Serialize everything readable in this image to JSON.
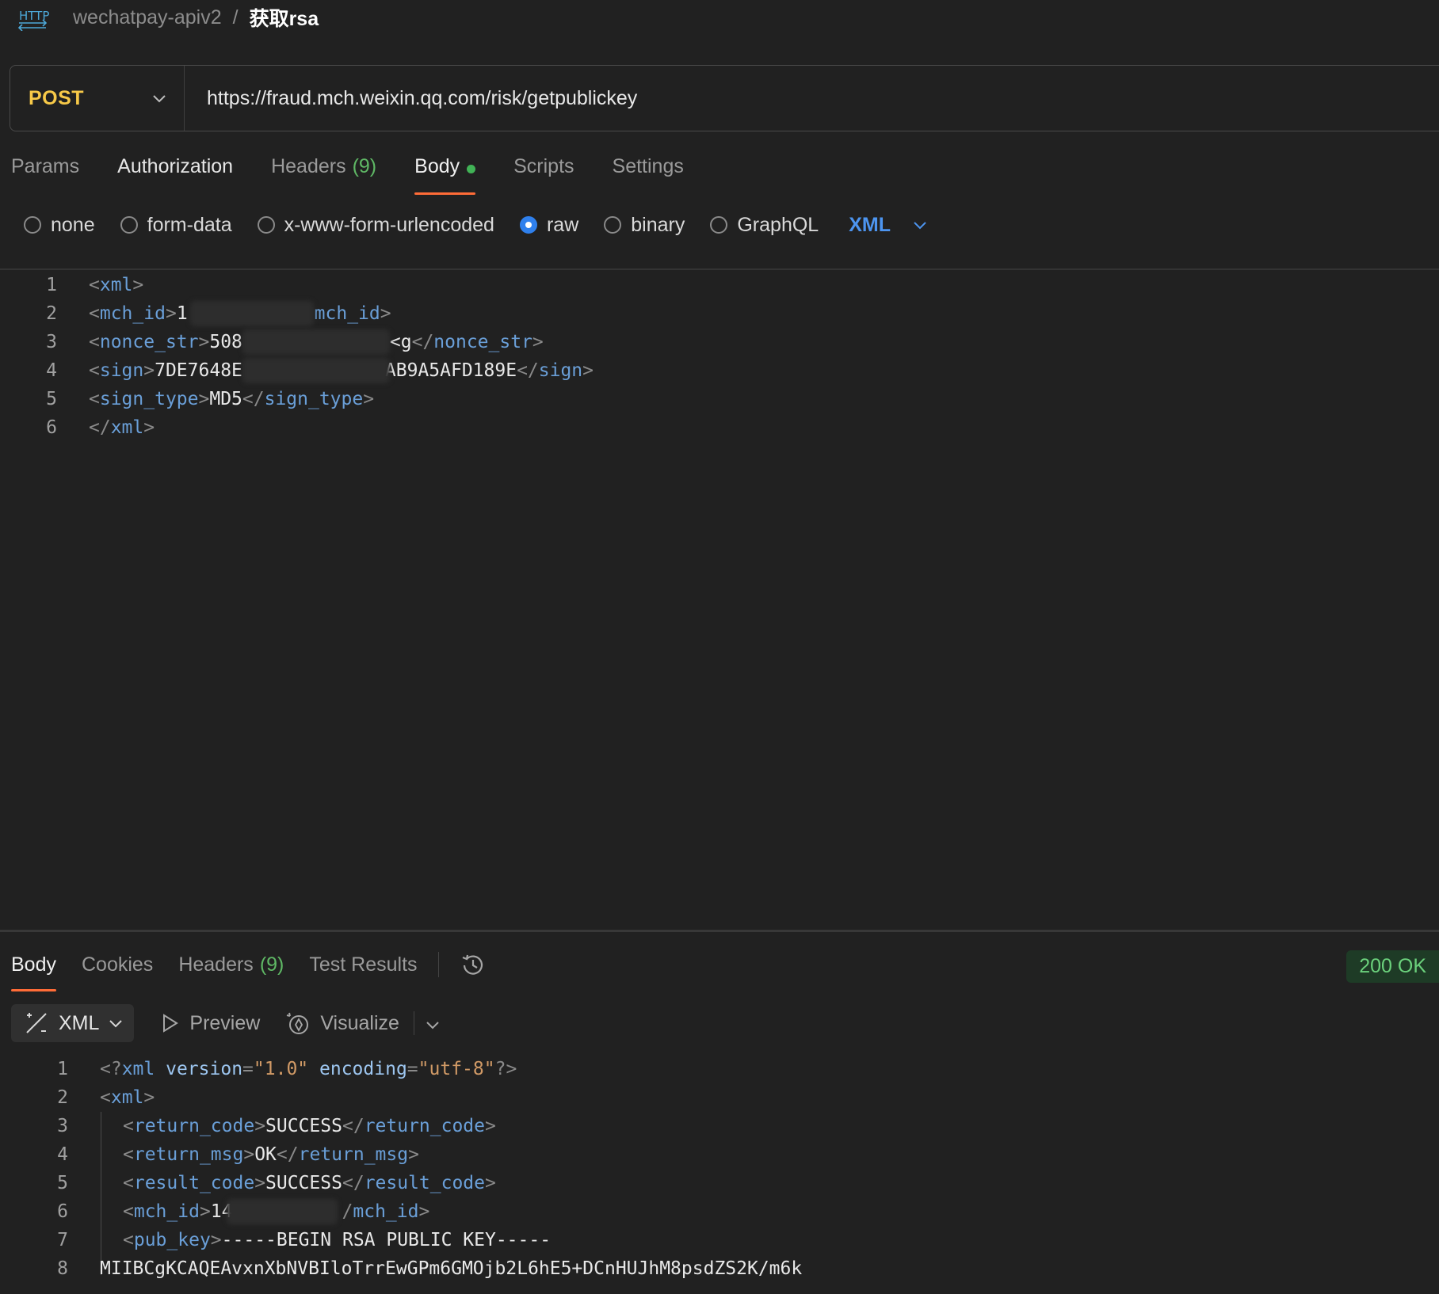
{
  "breadcrumb": {
    "collection": "wechatpay-apiv2",
    "separator": "/",
    "request": "获取rsa"
  },
  "request": {
    "method": "POST",
    "url": "https://fraud.mch.weixin.qq.com/risk/getpublickey"
  },
  "request_tabs": [
    {
      "label": "Params"
    },
    {
      "label": "Authorization"
    },
    {
      "label": "Headers",
      "count": "(9)"
    },
    {
      "label": "Body",
      "active": true,
      "indicator": "green-dot"
    },
    {
      "label": "Scripts"
    },
    {
      "label": "Settings"
    }
  ],
  "body_types": {
    "options": [
      "none",
      "form-data",
      "x-www-form-urlencoded",
      "raw",
      "binary",
      "GraphQL"
    ],
    "selected": "raw",
    "language": "XML"
  },
  "request_body": {
    "line_numbers": [
      "1",
      "2",
      "3",
      "4",
      "5",
      "6"
    ],
    "l1": {
      "open": "<",
      "tag": "xml",
      "close": ">"
    },
    "l2": {
      "open": "<",
      "tag": "mch_id",
      "close": ">",
      "value": "1",
      "tail_tag": "mch_id",
      "tail_close": ">"
    },
    "l3": {
      "open": "<",
      "tag": "nonce_str",
      "close": ">",
      "value": "508",
      "value_tail": "<g",
      "end_open": "</",
      "end_tag": "nonce_str",
      "end_close": ">"
    },
    "l4": {
      "open": "<",
      "tag": "sign",
      "close": ">",
      "value": "7DE7648E",
      "value_tail": "AB9A5AFD189E",
      "end_open": "</",
      "end_tag": "sign",
      "end_close": ">"
    },
    "l5": {
      "open": "<",
      "tag": "sign_type",
      "close": ">",
      "value": "MD5",
      "end_open": "</",
      "end_tag": "sign_type",
      "end_close": ">"
    },
    "l6": {
      "open": "</",
      "tag": "xml",
      "close": ">"
    }
  },
  "response_tabs": [
    {
      "label": "Body",
      "active": true
    },
    {
      "label": "Cookies"
    },
    {
      "label": "Headers",
      "count": "(9)"
    },
    {
      "label": "Test Results"
    }
  ],
  "response_status": "200 OK",
  "response_toolbar": {
    "format": "XML",
    "preview": "Preview",
    "visualize": "Visualize"
  },
  "response_body": {
    "line_numbers": [
      "1",
      "2",
      "3",
      "4",
      "5",
      "6",
      "7",
      "8"
    ],
    "l1": {
      "open": "<?",
      "tag": "xml",
      "attr1": "version",
      "eq": "=",
      "val1": "\"1.0\"",
      "attr2": "encoding",
      "val2": "\"utf-8\"",
      "close": "?>"
    },
    "l2": {
      "open": "<",
      "tag": "xml",
      "close": ">"
    },
    "l3": {
      "open": "<",
      "tag": "return_code",
      "close": ">",
      "value": "SUCCESS",
      "end_open": "</",
      "end_tag": "return_code",
      "end_close": ">"
    },
    "l4": {
      "open": "<",
      "tag": "return_msg",
      "close": ">",
      "value": "OK",
      "end_open": "</",
      "end_tag": "return_msg",
      "end_close": ">"
    },
    "l5": {
      "open": "<",
      "tag": "result_code",
      "close": ">",
      "value": "SUCCESS",
      "end_open": "</",
      "end_tag": "result_code",
      "end_close": ">"
    },
    "l6": {
      "open": "<",
      "tag": "mch_id",
      "close": ">",
      "value": "14",
      "end_open": "/",
      "end_tag": "mch_id",
      "end_close": ">"
    },
    "l7": {
      "open": "<",
      "tag": "pub_key",
      "close": ">",
      "value": "-----BEGIN RSA PUBLIC KEY-----"
    },
    "l8": {
      "value": "MIIBCgKCAQEAvxnXbNVBIloTrrEwGPm6GMOjb2L6hE5+DCnHUJhM8psdZS2K/m6k"
    }
  },
  "colors": {
    "accent_tab": "#ff6c37",
    "method": "#f7c948",
    "radio_selected": "#2f80ed",
    "status_ok": "#6bd17c"
  }
}
